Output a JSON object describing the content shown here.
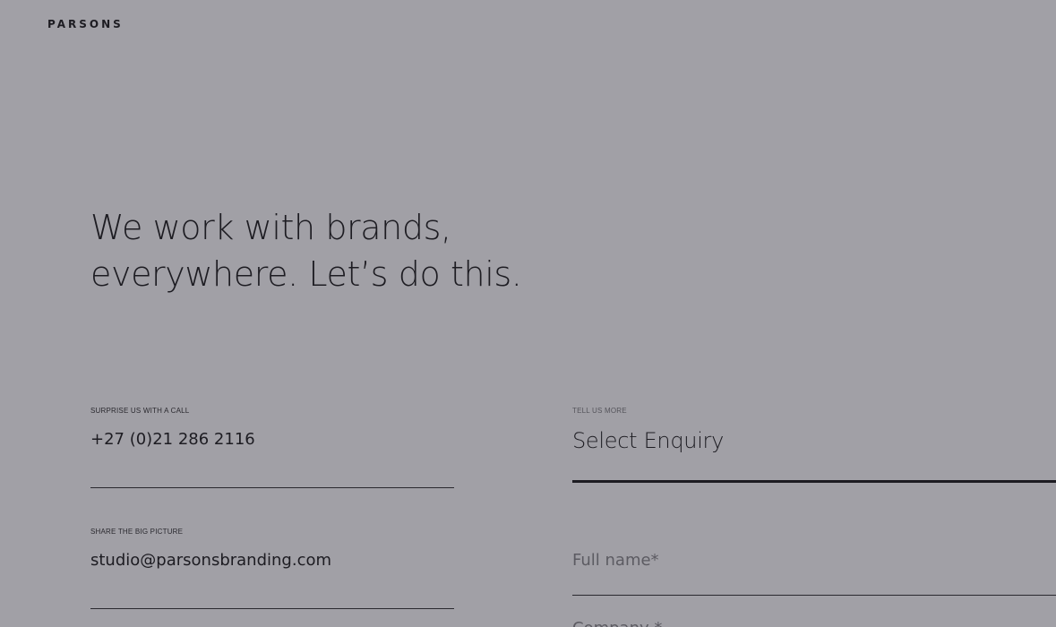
{
  "brand": {
    "logo_text": "PARSONS"
  },
  "hero": {
    "line1": "We work with brands,",
    "line2": "everywhere. Let’s do this."
  },
  "contact": {
    "phone": {
      "label": "SURPRISE US WITH A CALL",
      "value": "+27 (0)21 286 2116"
    },
    "email": {
      "label": "SHARE THE BIG PICTURE",
      "value": "studio@parsonsbranding.com"
    }
  },
  "form": {
    "section_label": "TELL US MORE",
    "enquiry_select": {
      "value": "Select Enquiry"
    },
    "full_name": {
      "placeholder": "Full name*",
      "value": ""
    },
    "company": {
      "placeholder": "Company *",
      "value": ""
    }
  },
  "colors": {
    "background": "#a1a0a6",
    "text": "#1d1c22",
    "muted": "#5c5b62"
  }
}
